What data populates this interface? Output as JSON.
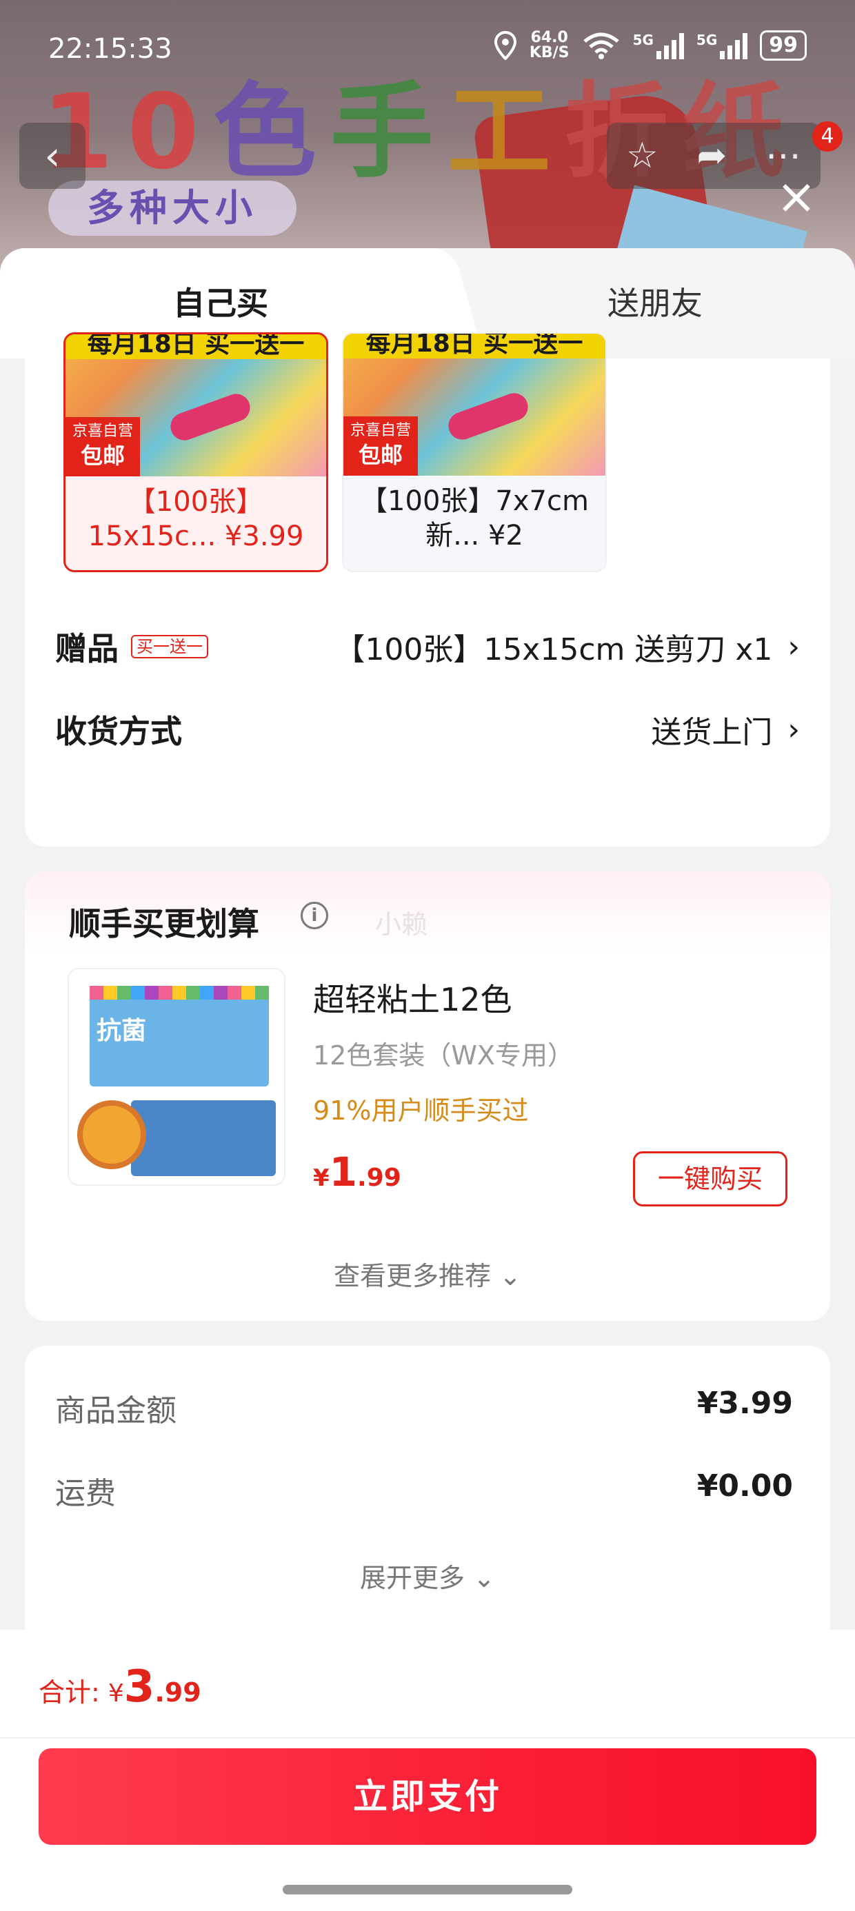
{
  "status_bar": {
    "time": "22:15:33",
    "speed_value": "64.0",
    "speed_unit": "KB/S",
    "net1": "5G",
    "net2": "5G",
    "battery": "99"
  },
  "banner": {
    "title_chars": [
      "10",
      "色",
      "手",
      "工",
      "折纸"
    ],
    "subtitle": "多种大小",
    "notification_count": "4"
  },
  "tabs": {
    "self": "自己买",
    "friend": "送朋友"
  },
  "sku_options": [
    {
      "promo": "每月18日 买一送一",
      "tag_top": "京喜自营",
      "tag_bottom": "包邮",
      "label": "【100张】 15x15c... ¥3.99",
      "selected": true
    },
    {
      "promo": "每月18日 买一送一",
      "tag_top": "京喜自营",
      "tag_bottom": "包邮",
      "label": "【100张】7x7cm 新... ¥2",
      "selected": false
    }
  ],
  "gift": {
    "title": "赠品",
    "tag": "买一送一",
    "value": "【100张】15x15cm 送剪刀 x1"
  },
  "delivery": {
    "title": "收货方式",
    "value": "送货上门"
  },
  "recommend": {
    "title": "顺手买更划算",
    "faint_label": "小赖",
    "product_name": "超轻粘土12色",
    "spec": "12色套装（WX专用）",
    "stat": "91%用户顺手买过",
    "price_currency": "¥",
    "price_int": "1",
    "price_dec": ".99",
    "buy_label": "一键购买",
    "image_text": "抗菌",
    "more_label": "查看更多推荐"
  },
  "summary": {
    "goods_label": "商品金额",
    "goods_amount": "¥3.99",
    "shipping_label": "运费",
    "shipping_amount": "¥0.00",
    "expand_label": "展开更多"
  },
  "footer": {
    "total_label": "合计: ",
    "total_currency": "¥",
    "total_int": "3",
    "total_dec": ".99",
    "pay_label": "立即支付"
  },
  "colors": {
    "accent": "#e2231a",
    "pay_gradient_start": "#ff3b4f",
    "pay_gradient_end": "#f8102a",
    "stat_orange": "#d68a1a"
  }
}
